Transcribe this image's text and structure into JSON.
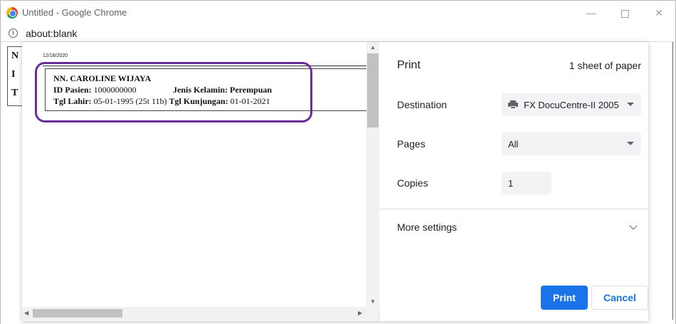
{
  "window": {
    "title": "Untitled - Google Chrome",
    "minimize": "—",
    "close": "✕"
  },
  "address_bar": {
    "url": "about:blank",
    "info_icon": "i"
  },
  "background_page": {
    "letters": [
      "N",
      "I",
      "T"
    ]
  },
  "preview": {
    "date": "12/18/2020",
    "patient_name": "NN. CAROLINE WIJAYA",
    "id_label": "ID Pasien:",
    "id_value": "1000000000",
    "gender_label": "Jenis Kelamin: Perempuan",
    "dob_label": "Tgl Lahir:",
    "dob_value": "05-01-1995 (25t 11b)",
    "visit_label": "Tgl Kunjungan:",
    "visit_value": "01-01-2021",
    "highlight_color": "#6b2e98"
  },
  "print_settings": {
    "title": "Print",
    "sheet_count": "1 sheet of paper",
    "destination_label": "Destination",
    "destination_value": "FX DocuCentre-II 2005",
    "pages_label": "Pages",
    "pages_value": "All",
    "copies_label": "Copies",
    "copies_value": "1",
    "more_settings_label": "More settings",
    "print_button": "Print",
    "cancel_button": "Cancel",
    "accent_color": "#1a73e8"
  }
}
